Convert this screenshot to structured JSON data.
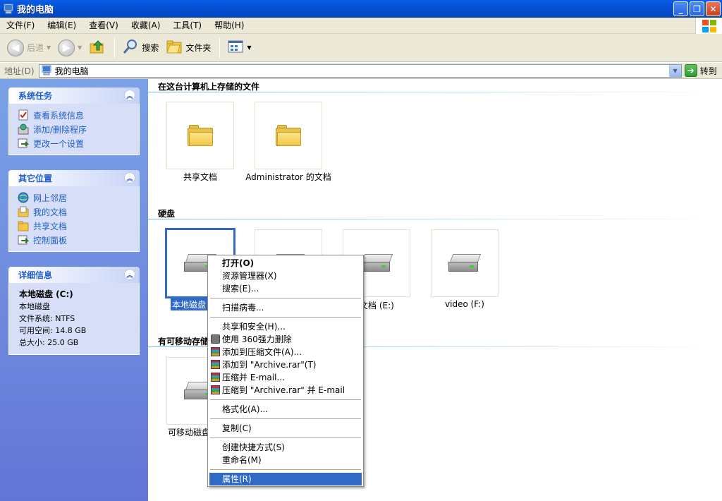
{
  "window": {
    "title": "我的电脑",
    "minimize": "_",
    "restore": "❐",
    "close": "✕"
  },
  "menu": [
    "文件(F)",
    "编辑(E)",
    "查看(V)",
    "收藏(A)",
    "工具(T)",
    "帮助(H)"
  ],
  "toolbar": {
    "back": "后退",
    "search": "搜索",
    "folders": "文件夹"
  },
  "address": {
    "label": "地址(D)",
    "value": "我的电脑",
    "go": "转到"
  },
  "taskpane": {
    "system_tasks": {
      "title": "系统任务",
      "items": [
        "查看系统信息",
        "添加/删除程序",
        "更改一个设置"
      ]
    },
    "other_places": {
      "title": "其它位置",
      "items": [
        "网上邻居",
        "我的文档",
        "共享文档",
        "控制面板"
      ]
    },
    "details": {
      "title": "详细信息",
      "name": "本地磁盘 (C:)",
      "type": "本地磁盘",
      "fs": "文件系统: NTFS",
      "free": "可用空间: 14.8 GB",
      "total": "总大小: 25.0 GB"
    }
  },
  "main": {
    "files_section": "在这台计算机上存储的文件",
    "files": [
      "共享文档",
      "Administrator 的文档"
    ],
    "disks_section": "硬盘",
    "disks": [
      "本地磁盘",
      "文档 (E:)",
      "video (F:)"
    ],
    "removable_section": "有可移动存储",
    "removable": [
      "可移动磁盘"
    ]
  },
  "context_menu": {
    "open": "打开(O)",
    "explorer": "资源管理器(X)",
    "search": "搜索(E)...",
    "scan": "扫描病毒...",
    "share": "共享和安全(H)...",
    "delete360": "使用 360强力删除",
    "add_archive": "添加到压缩文件(A)...",
    "add_rar": "添加到 \"Archive.rar\"(T)",
    "compress_email": "压缩并 E-mail...",
    "compress_rar_email": "压缩到 \"Archive.rar\" 并 E-mail",
    "format": "格式化(A)...",
    "copy": "复制(C)",
    "shortcut": "创建快捷方式(S)",
    "rename": "重命名(M)",
    "properties": "属性(R)"
  }
}
